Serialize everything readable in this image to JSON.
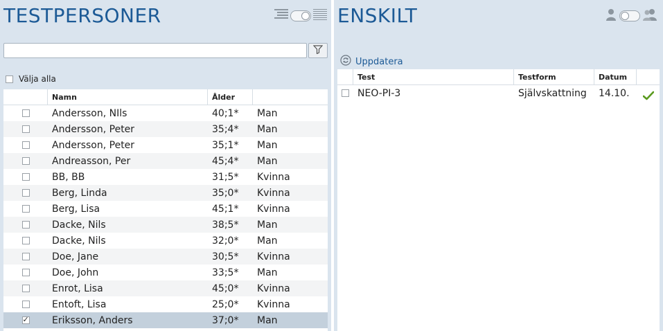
{
  "left": {
    "title": "TESTPERSONER",
    "view_toggle": {
      "left_icon": "list-view-icon",
      "right_icon": "detail-list-icon"
    },
    "search": {
      "value": "",
      "placeholder": ""
    },
    "select_all_label": "Välja alla",
    "columns": [
      "",
      "Namn",
      "Ålder",
      ""
    ],
    "rows": [
      {
        "name": "Andersson, NIls",
        "age": "40;1*",
        "gender": "Man",
        "checked": false,
        "selected": false
      },
      {
        "name": "Andersson, Peter",
        "age": "35;4*",
        "gender": "Man",
        "checked": false,
        "selected": false
      },
      {
        "name": "Andersson, Peter",
        "age": "35;1*",
        "gender": "Man",
        "checked": false,
        "selected": false
      },
      {
        "name": "Andreasson, Per",
        "age": "45;4*",
        "gender": "Man",
        "checked": false,
        "selected": false
      },
      {
        "name": "BB, BB",
        "age": "31;5*",
        "gender": "Kvinna",
        "checked": false,
        "selected": false
      },
      {
        "name": "Berg, Linda",
        "age": "35;0*",
        "gender": "Kvinna",
        "checked": false,
        "selected": false
      },
      {
        "name": "Berg, Lisa",
        "age": "45;1*",
        "gender": "Kvinna",
        "checked": false,
        "selected": false
      },
      {
        "name": "Dacke, Nils",
        "age": "38;5*",
        "gender": "Man",
        "checked": false,
        "selected": false
      },
      {
        "name": "Dacke, Nils",
        "age": "32;0*",
        "gender": "Man",
        "checked": false,
        "selected": false
      },
      {
        "name": "Doe, Jane",
        "age": "30;5*",
        "gender": "Kvinna",
        "checked": false,
        "selected": false
      },
      {
        "name": "Doe, John",
        "age": "33;5*",
        "gender": "Man",
        "checked": false,
        "selected": false
      },
      {
        "name": "Enrot, Lisa",
        "age": "45;0*",
        "gender": "Kvinna",
        "checked": false,
        "selected": false
      },
      {
        "name": "Entoft, Lisa",
        "age": "25;0*",
        "gender": "Kvinna",
        "checked": false,
        "selected": false
      },
      {
        "name": "Eriksson, Anders",
        "age": "37;0*",
        "gender": "Man",
        "checked": true,
        "selected": true
      }
    ]
  },
  "right": {
    "title": "ENSKILT",
    "view_toggle": {
      "left_icon": "single-person-icon",
      "right_icon": "group-people-icon"
    },
    "update_label": "Uppdatera",
    "columns": [
      "",
      "Test",
      "Testform",
      "Datum",
      ""
    ],
    "rows": [
      {
        "test": "NEO-PI-3",
        "form": "Självskattning",
        "date": "14.10.",
        "status_icon": "checkmark-icon",
        "checked": false
      }
    ]
  },
  "colors": {
    "panel_bg": "#dae4ee",
    "title": "#1c5a96",
    "selected_row": "#c3d0dc",
    "check_green": "#5a9a1e"
  }
}
